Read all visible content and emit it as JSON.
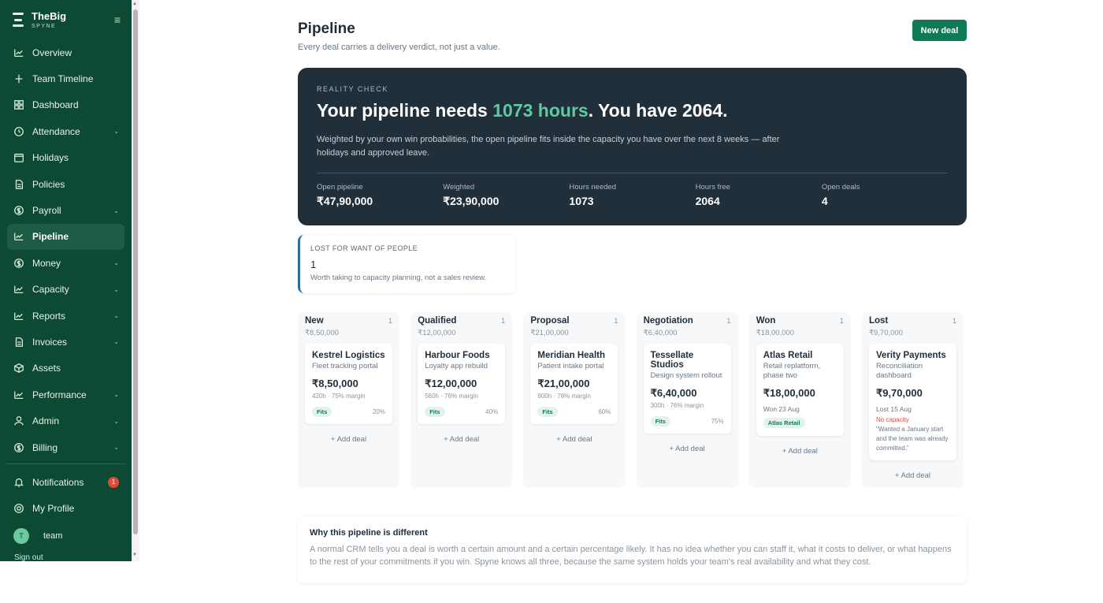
{
  "sidebar": {
    "brand_name": "TheBig",
    "brand_sub": "SPYNE",
    "items": [
      {
        "label": "Overview",
        "icon": "trend-icon",
        "chevron": ""
      },
      {
        "label": "Team Timeline",
        "icon": "timeline-icon",
        "chevron": ""
      },
      {
        "label": "Dashboard",
        "icon": "grid-icon",
        "chevron": ""
      },
      {
        "label": "Attendance",
        "icon": "clock-icon",
        "chevron": "⌄"
      },
      {
        "label": "Holidays",
        "icon": "calendar-icon",
        "chevron": ""
      },
      {
        "label": "Policies",
        "icon": "document-icon",
        "chevron": ""
      },
      {
        "label": "Payroll",
        "icon": "dollar-icon",
        "chevron": "⌄"
      },
      {
        "label": "Pipeline",
        "icon": "trend-icon",
        "chevron": ""
      },
      {
        "label": "Money",
        "icon": "dollar-icon",
        "chevron": "⌄"
      },
      {
        "label": "Capacity",
        "icon": "trend-icon",
        "chevron": "⌄"
      },
      {
        "label": "Reports",
        "icon": "trend-icon",
        "chevron": "⌄"
      },
      {
        "label": "Invoices",
        "icon": "document-icon",
        "chevron": "⌄"
      },
      {
        "label": "Assets",
        "icon": "box-icon",
        "chevron": ""
      },
      {
        "label": "Performance",
        "icon": "trend-icon",
        "chevron": "⌄"
      },
      {
        "label": "Admin",
        "icon": "user-icon",
        "chevron": "⌄"
      },
      {
        "label": "Billing",
        "icon": "dollar-icon",
        "chevron": "⌄"
      }
    ],
    "notifications_label": "Notifications",
    "notifications_count": "1",
    "profile_label": "My Profile",
    "user_initial": "T",
    "user_name": "team",
    "signout_label": "Sign out"
  },
  "header": {
    "title": "Pipeline",
    "subtitle": "Every deal carries a delivery verdict, not just a value.",
    "new_deal_label": "New deal"
  },
  "hero": {
    "eyebrow": "REALITY CHECK",
    "title_prefix": "Your pipeline needs ",
    "title_highlight": "1073 hours",
    "title_suffix": ". You have 2064.",
    "description": "Weighted by your own win probabilities, the open pipeline fits inside the capacity you have over the next 8 weeks — after holidays and approved leave.",
    "stats": [
      {
        "label": "Open pipeline",
        "value": "₹47,90,000"
      },
      {
        "label": "Weighted",
        "value": "₹23,90,000"
      },
      {
        "label": "Hours needed",
        "value": "1073"
      },
      {
        "label": "Hours free",
        "value": "2064"
      },
      {
        "label": "Open deals",
        "value": "4"
      }
    ]
  },
  "lost_card": {
    "eyebrow": "LOST FOR WANT OF PEOPLE",
    "count": "1",
    "description": "Worth taking to capacity planning, not a sales review."
  },
  "columns": [
    {
      "name": "New",
      "count": "1",
      "total": "₹8,50,000",
      "deal": {
        "name": "Kestrel Logistics",
        "desc": "Fleet tracking portal",
        "value": "₹8,50,000",
        "meta": "420h · 75% margin",
        "pill": "Fits",
        "pct": "20%"
      }
    },
    {
      "name": "Qualified",
      "count": "1",
      "total": "₹12,00,000",
      "deal": {
        "name": "Harbour Foods",
        "desc": "Loyalty app rebuild",
        "value": "₹12,00,000",
        "meta": "560h · 76% margin",
        "pill": "Fits",
        "pct": "40%"
      }
    },
    {
      "name": "Proposal",
      "count": "1",
      "total": "₹21,00,000",
      "deal": {
        "name": "Meridian Health",
        "desc": "Patient intake portal",
        "value": "₹21,00,000",
        "meta": "900h · 78% margin",
        "pill": "Fits",
        "pct": "60%"
      }
    },
    {
      "name": "Negotiation",
      "count": "1",
      "total": "₹6,40,000",
      "deal": {
        "name": "Tessellate Studios",
        "desc": "Design system rollout",
        "value": "₹6,40,000",
        "meta": "300h · 76% margin",
        "pill": "Fits",
        "pct": "75%"
      }
    },
    {
      "name": "Won",
      "count": "1",
      "total": "₹18,00,000",
      "deal": {
        "name": "Atlas Retail",
        "desc": "Retail replatform, phase two",
        "value": "₹18,00,000",
        "date": "Won 23 Aug",
        "tag": "Atlas Retail"
      }
    },
    {
      "name": "Lost",
      "count": "1",
      "total": "₹9,70,000",
      "deal": {
        "name": "Verity Payments",
        "desc": "Reconciliation dashboard",
        "value": "₹9,70,000",
        "date": "Lost 15 Aug",
        "reason": "No capacity",
        "quote": "\"Wanted a January start and the team was already committed.\""
      }
    }
  ],
  "add_deal_label": "+ Add deal",
  "why": {
    "title": "Why this pipeline is different",
    "text": "A normal CRM tells you a deal is worth a certain amount and a certain percentage likely. It has no idea whether you can staff it, what it costs to deliver, or what happens to the rest of your commitments if you win. Spyne knows all three, because the same system holds your team's real availability and what they cost."
  },
  "colors": {
    "sidebar": "#0d4a33",
    "accent": "#0f7a55",
    "hero": "#212f3b",
    "highlight": "#5fc9a3",
    "danger": "#d9534f"
  }
}
